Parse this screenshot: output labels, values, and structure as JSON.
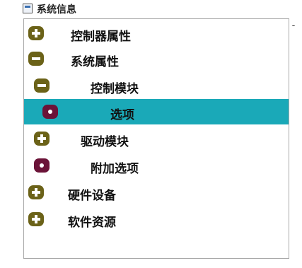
{
  "window": {
    "title": "系统信息"
  },
  "tree": {
    "items": [
      {
        "label": "控制器属性",
        "icon": "plus"
      },
      {
        "label": "系统属性",
        "icon": "minus"
      },
      {
        "label": "控制模块",
        "icon": "minus"
      },
      {
        "label": "选项",
        "icon": "leaf",
        "selected": true
      },
      {
        "label": "驱动模块",
        "icon": "plus"
      },
      {
        "label": "附加选项",
        "icon": "leaf"
      },
      {
        "label": "硬件设备",
        "icon": "plus"
      },
      {
        "label": "软件资源",
        "icon": "plus"
      }
    ]
  },
  "scrollbar": {
    "glyph": "-"
  }
}
